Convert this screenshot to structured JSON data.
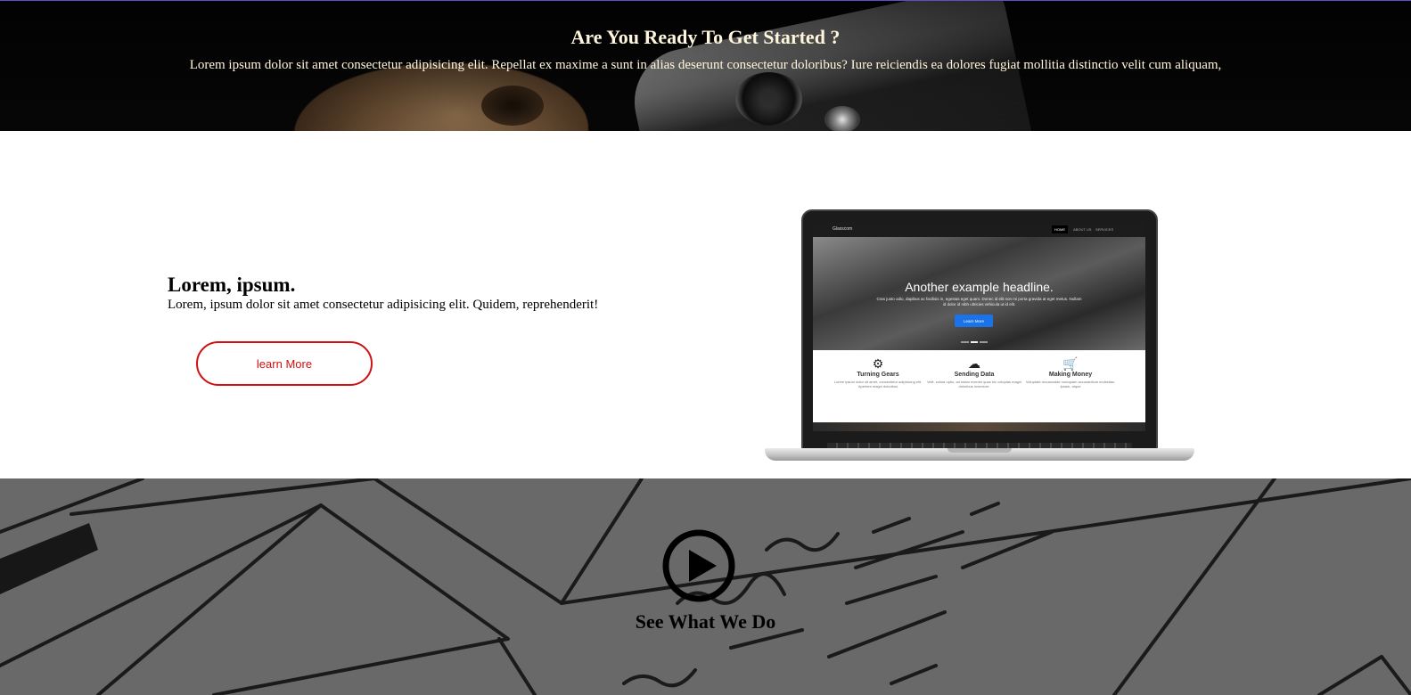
{
  "hero": {
    "title": "Are You Ready To Get Started ?",
    "text": "Lorem ipsum dolor sit amet consectetur adipisicing elit. Repellat ex maxime a sunt in alias deserunt consectetur doloribus? Iure reiciendis ea dolores fugiat mollitia distinctio velit cum aliquam,"
  },
  "feature": {
    "title": "Lorem, ipsum.",
    "text": "Lorem, ipsum dolor sit amet consectetur adipisicing elit. Quidem, reprehenderit!",
    "button_label": "learn More",
    "button_color": "#d11010"
  },
  "laptop_screen": {
    "brand": "Glasscom",
    "nav": [
      "HOME",
      "ABOUT US",
      "SERVICES"
    ],
    "headline": "Another example headline.",
    "subtext": "Cras justo odio, dapibus ac facilisis in, egestas eget quam. Donec id elit non mi porta gravida at eget metus. Nullam id dolor id nibh ultricies vehicula ut id elit.",
    "button_label": "Learn More",
    "features": [
      {
        "icon": "gear-icon",
        "title": "Turning Gears",
        "text": "Lorem ipsum dolor sit amet, consectetur adipisicing elit. Aperiam magni doloribus"
      },
      {
        "icon": "cloud-icon",
        "title": "Sending Data",
        "text": "Velit, soluta optio, ad totam eveniet quas hic voluptas magni doloribus inventore."
      },
      {
        "icon": "cart-icon",
        "title": "Making Money",
        "text": "Voluptate recusandae numquam accusantium molestias. Ipsam, atque"
      }
    ]
  },
  "video": {
    "title": "See What We Do",
    "icon": "play-icon"
  }
}
